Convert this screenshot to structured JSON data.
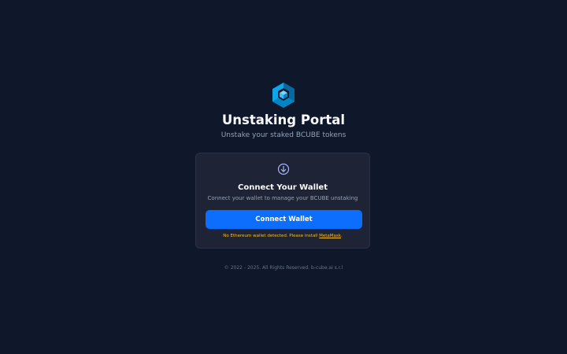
{
  "header": {
    "logo_icon": "bcube-cube-logo-icon",
    "title": "Unstaking Portal",
    "subtitle": "Unstake your staked BCUBE tokens"
  },
  "card": {
    "icon": "arrow-down-circle-icon",
    "title": "Connect Your Wallet",
    "description": "Connect your wallet to manage your BCUBE unstaking",
    "button_label": "Connect Wallet",
    "warning_prefix": "No Ethereum wallet detected. Please install ",
    "warning_link": "MetaMask",
    "warning_suffix": "."
  },
  "footer": {
    "copyright": "© 2022 - 2025. All Rights Reserved. b-cube.ai s.r.l"
  },
  "colors": {
    "background": "#0f172a",
    "card_background": "#1e2335",
    "primary_button": "#0d6efd",
    "warning_text": "#fbbf24",
    "icon_accent": "#a5b4fc",
    "logo_light": "#38bdf8",
    "logo_dark": "#0369a1"
  }
}
